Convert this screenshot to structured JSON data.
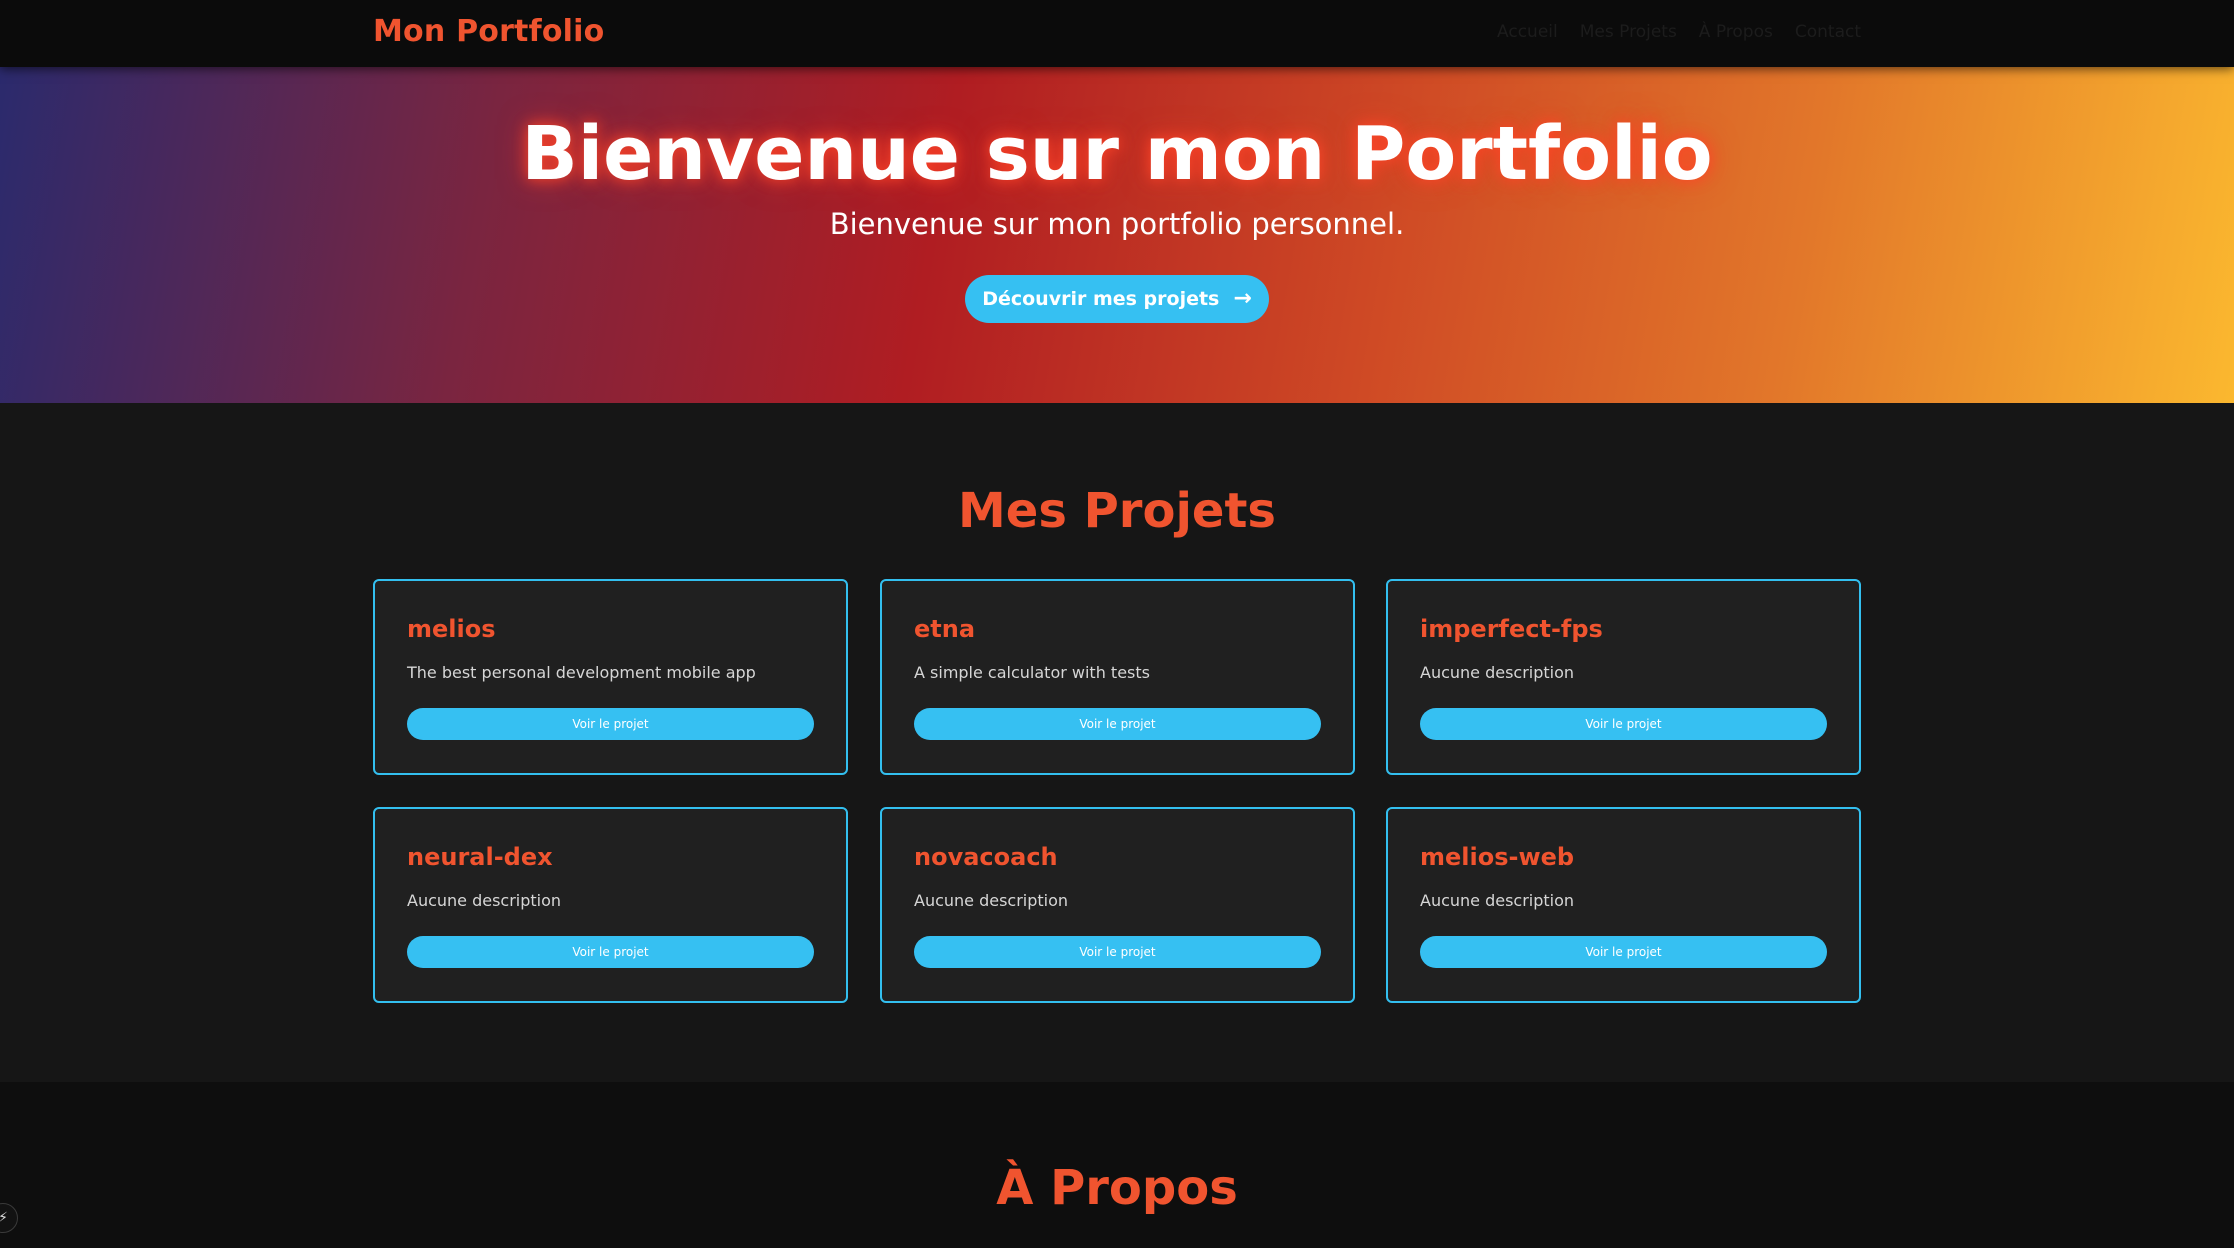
{
  "nav": {
    "brand": "Mon Portfolio",
    "links": [
      "Accueil",
      "Mes Projets",
      "À Propos",
      "Contact"
    ]
  },
  "hero": {
    "title": "Bienvenue sur mon Portfolio",
    "subtitle": "Bienvenue sur mon portfolio personnel.",
    "cta_label": "Découvrir mes projets",
    "cta_icon": "arrow-right-icon"
  },
  "projects": {
    "title": "Mes Projets",
    "button_label": "Voir le projet",
    "items": [
      {
        "name": "melios",
        "description": "The best personal development mobile app"
      },
      {
        "name": "etna",
        "description": "A simple calculator with tests"
      },
      {
        "name": "imperfect-fps",
        "description": "Aucune description"
      },
      {
        "name": "neural-dex",
        "description": "Aucune description"
      },
      {
        "name": "novacoach",
        "description": "Aucune description"
      },
      {
        "name": "melios-web",
        "description": "Aucune description"
      }
    ]
  },
  "about": {
    "title": "À Propos"
  },
  "colors": {
    "accent": "#f0542f",
    "button": "#36c0f2",
    "card_border": "#33bfef",
    "card_bg": "#202020",
    "section_bg": "#161616",
    "page_bg": "#0e0e0e"
  }
}
